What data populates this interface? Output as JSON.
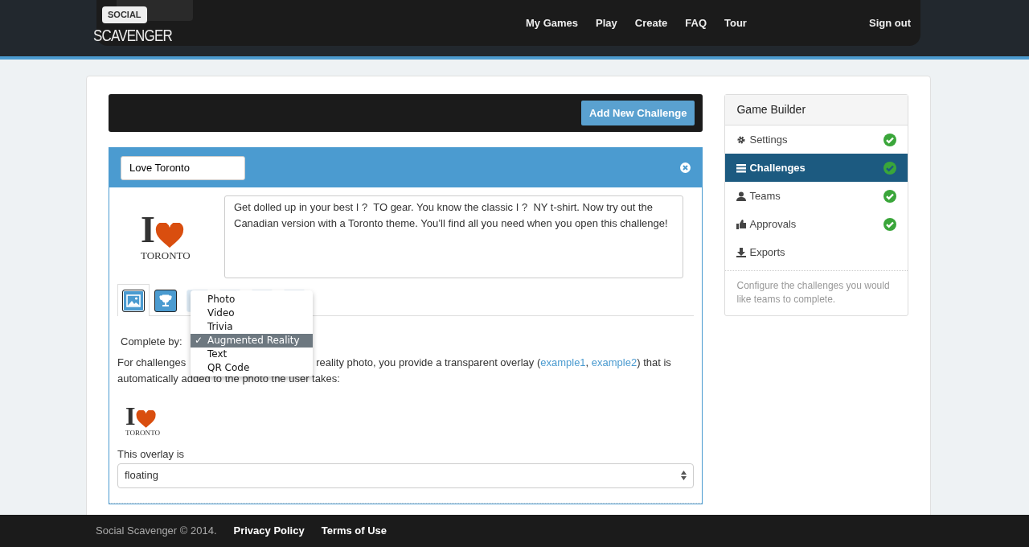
{
  "header": {
    "logo_badge": "SOCIAL",
    "logo_word": "SCAVENGER",
    "nav": [
      {
        "label": "My Games"
      },
      {
        "label": "Play"
      },
      {
        "label": "Create"
      },
      {
        "label": "FAQ"
      },
      {
        "label": "Tour"
      }
    ],
    "sign_out": "Sign out"
  },
  "toolbar": {
    "add_button": "Add New Challenge"
  },
  "challenge": {
    "title": "Love Toronto",
    "logo": {
      "letter": "I",
      "word": "TORONTO"
    },
    "description": "Get dolled up in your best I ?  TO gear. You know the classic I ?  NY t-shirt. Now try out the Canadian version with a Toronto theme. You’ll find all you need when you open this challenge!",
    "tabs": [
      {
        "selected": true
      },
      {
        "selected": false
      },
      {
        "selected": false
      },
      {
        "selected": false
      },
      {
        "selected": false
      },
      {
        "selected": false
      }
    ],
    "complete_by_label": "Complete by:",
    "menu": [
      {
        "label": "Photo",
        "selected": false
      },
      {
        "label": "Video",
        "selected": false
      },
      {
        "label": "Trivia",
        "selected": false
      },
      {
        "label": "Augmented Reality",
        "selected": true,
        "check": "✓"
      },
      {
        "label": "Text",
        "selected": false
      },
      {
        "label": "QR Code",
        "selected": false
      }
    ],
    "help_start": "For challenges",
    "help_before": "reality photo, you provide a transparent overlay (",
    "link1": "example1",
    "sep": ", ",
    "link2": "example2",
    "help_after": ") that is",
    "help_line2": "automatically added to the photo the user takes:",
    "overlay_logo": {
      "letter": "I",
      "word": "TORONTO"
    },
    "overlay_label": "This overlay is",
    "overlay_value": "floating"
  },
  "sidebar": {
    "title": "Game Builder",
    "items": [
      {
        "label": "Settings",
        "selected": false,
        "done": true
      },
      {
        "label": "Challenges",
        "selected": true,
        "done": true
      },
      {
        "label": "Teams",
        "selected": false,
        "done": true
      },
      {
        "label": "Approvals",
        "selected": false,
        "done": true
      },
      {
        "label": "Exports",
        "selected": false,
        "done": false
      }
    ],
    "note": "Configure the challenges you would like teams to complete."
  },
  "footer": {
    "copyright": "Social Scavenger © 2014.",
    "links": [
      "Privacy Policy",
      "Terms of Use"
    ]
  }
}
